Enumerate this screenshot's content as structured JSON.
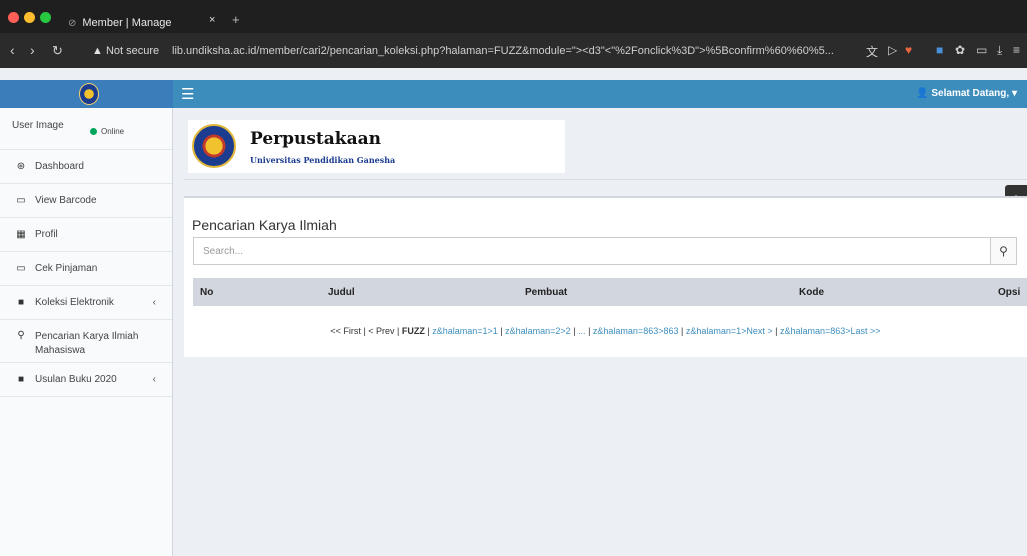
{
  "browser": {
    "tab_title": "Member | Manage",
    "tab_close": "×",
    "tab_new": "+",
    "secure_label": "Not secure",
    "url": "lib.undiksha.ac.id/member/cari2/pencarian_koleksi.php?halaman=FUZZ&module=\"><d3\"<\"%2Fonclick%3D\">%5Bconfirm%60%60%5...",
    "traffic_colors": [
      "#ff5f57",
      "#febc2e",
      "#28c840"
    ]
  },
  "header": {
    "hamburger_icon": "menu-icon",
    "user_menu_label": "Selamat Datang,"
  },
  "sidebar": {
    "user_image_alt": "User Image",
    "online_label": "Online",
    "items": [
      {
        "label": "Dashboard",
        "icon": "dashboard-icon"
      },
      {
        "label": "View Barcode",
        "icon": "laptop-icon"
      },
      {
        "label": "Profil",
        "icon": "grid-icon"
      },
      {
        "label": "Cek Pinjaman",
        "icon": "laptop-icon"
      },
      {
        "label": "Koleksi Elektronik",
        "icon": "folder-icon"
      },
      {
        "label": "Pencarian Karya Ilmiah Mahasiswa",
        "icon": "search-icon"
      },
      {
        "label": "Usulan Buku 2020",
        "icon": "folder-icon"
      }
    ]
  },
  "banner": {
    "title": "Perpustakaan",
    "subtitle": "Universitas Pendidikan Ganesha"
  },
  "panel": {
    "title": "Pencarian Karya Ilmiah",
    "search_placeholder": "Search..."
  },
  "table": {
    "columns": [
      "No",
      "Judul",
      "Pembuat",
      "Kode",
      "Opsi"
    ]
  },
  "pagination": {
    "first": "<< First",
    "prev": "< Prev",
    "current": "FUZZ",
    "page1": "z&halaman=1>1",
    "page2": "z&halaman=2>2",
    "ellipsis": "...",
    "page863": "z&halaman=863>863",
    "next": "z&halaman=1>Next >",
    "last": "z&halaman=863>Last >>"
  }
}
